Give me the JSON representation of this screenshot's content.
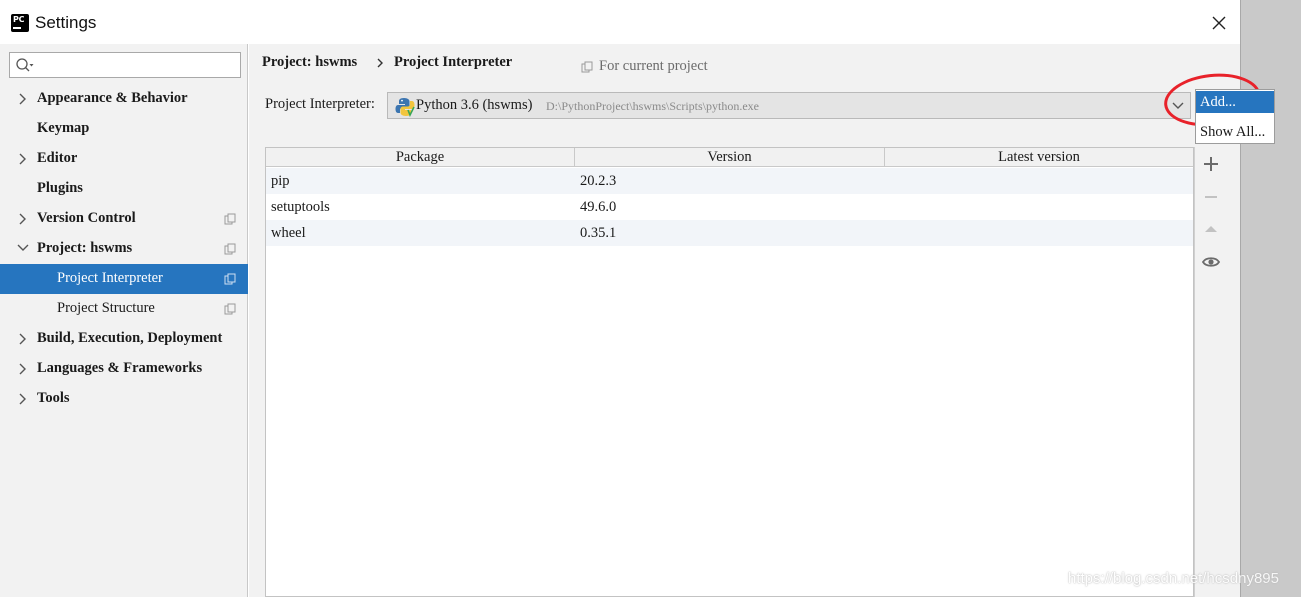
{
  "window": {
    "title": "Settings"
  },
  "sidebar": {
    "search_value": "",
    "items": [
      {
        "label": "Appearance & Behavior",
        "expandable": true,
        "expanded": false
      },
      {
        "label": "Keymap",
        "expandable": false
      },
      {
        "label": "Editor",
        "expandable": true,
        "expanded": false
      },
      {
        "label": "Plugins",
        "expandable": false
      },
      {
        "label": "Version Control",
        "expandable": true,
        "expanded": false
      },
      {
        "label": "Project: hswms",
        "expandable": true,
        "expanded": true
      },
      {
        "label": "Project Interpreter",
        "child": true,
        "selected": true
      },
      {
        "label": "Project Structure",
        "child": true
      },
      {
        "label": "Build, Execution, Deployment",
        "expandable": true,
        "expanded": false
      },
      {
        "label": "Languages & Frameworks",
        "expandable": true,
        "expanded": false
      },
      {
        "label": "Tools",
        "expandable": true,
        "expanded": false
      }
    ]
  },
  "breadcrumb": {
    "parent": "Project: hswms",
    "current": "Project Interpreter",
    "scope": "For current project"
  },
  "interpreter": {
    "label": "Project Interpreter:",
    "name": "Python 3.6 (hswms)",
    "path": "D:\\PythonProject\\hswms\\Scripts\\python.exe"
  },
  "gear_menu": {
    "items": [
      "Add...",
      "Show All..."
    ],
    "highlighted": "Add..."
  },
  "packages": {
    "columns": [
      "Package",
      "Version",
      "Latest version"
    ],
    "rows": [
      {
        "package": "pip",
        "version": "20.2.3",
        "latest": ""
      },
      {
        "package": "setuptools",
        "version": "49.6.0",
        "latest": ""
      },
      {
        "package": "wheel",
        "version": "0.35.1",
        "latest": ""
      }
    ]
  },
  "toolbar": {
    "icons": [
      "plus-icon",
      "minus-icon",
      "upgrade-icon",
      "eye-icon"
    ]
  },
  "watermark": "https://blog.csdn.net/hcsdny895",
  "colors": {
    "selection": "#2675bf",
    "annotation_ring": "#e8222a"
  }
}
